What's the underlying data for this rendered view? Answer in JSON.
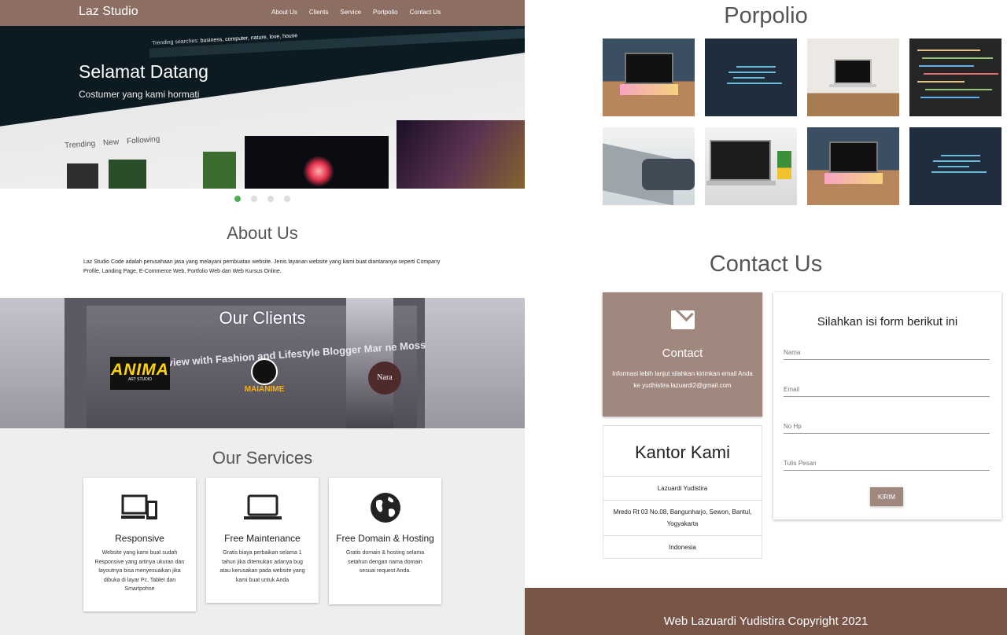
{
  "navbar": {
    "brand": "Laz Studio",
    "links": [
      "About Us",
      "Clients",
      "Service",
      "Portpolio",
      "Contact Us"
    ]
  },
  "hero": {
    "title": "Selamat Datang",
    "subtitle": "Costumer yang kami hormati",
    "trending_label": "Trending searches:",
    "trending_terms": "business, computer, nature, love, house",
    "tabs": [
      "Trending",
      "New",
      "Following"
    ],
    "slides_total": 4,
    "active_slide": 1
  },
  "about": {
    "title": "About Us",
    "text": "Laz Studio Code adalah perusahaan jasa yang melayani pembuatan website. Jenis layanan website yang kami buat diantaranya seperti Company Profile, Landing Page, E-Commerce Web, Portfolio Web dan Web Kursus Online."
  },
  "clients": {
    "title": "Our Clients",
    "background_text": "erview with Fashion and Lifestyle Blogger Mar        ne Moss",
    "logos": [
      {
        "name": "ANIMA",
        "caption": "ART STUDIO"
      },
      {
        "name": "MAIANIME"
      },
      {
        "name": "Nara"
      }
    ]
  },
  "services": {
    "title": "Our Services",
    "items": [
      {
        "icon": "devices-icon",
        "title": "Responsive",
        "text": "Website yang kami buat sudah Responsive yang artinya ukuran dan layoutnya bisa menyesuaikan jika dibuka di layar Pc, Tablet dan Smartpohne"
      },
      {
        "icon": "laptop-icon",
        "title": "Free Maintenance",
        "text": "Gratis biaya perbaikan selama 1 tahun jika ditemukan adanya bug atau kerusakan pada website yang kami buat untuk Anda"
      },
      {
        "icon": "globe-icon",
        "title": "Free Domain & Hosting",
        "text": "Gratis domain & hosting selama setahun dengan nama domain sesuai request Anda."
      }
    ]
  },
  "portfolio": {
    "title": "Porpolio"
  },
  "contact": {
    "title": "Contact Us",
    "card": {
      "icon": "mail-icon",
      "title": "Contact",
      "text": "Informasi lebih lanjut silahkan kirimkan email Anda ke yudhistira.lazuardi2@gmail.com"
    },
    "office": {
      "title": "Kantor Kami",
      "name": "Lazuardi Yudistira",
      "address": "Mredo Rt 03 No.08, Bangunharjo, Sewon, Bantul, Yogyakarta",
      "country": "Indonesia"
    },
    "form": {
      "title": "Silahkan isi form berikut ini",
      "name_placeholder": "Nama",
      "email_placeholder": "Email",
      "phone_placeholder": "No Hp",
      "message_placeholder": "Tulis Pesan",
      "submit_label": "KIRIM"
    }
  },
  "footer": {
    "text": "Web Lazuardi Yudistira Copyright 2021"
  },
  "colors": {
    "navbar": "#8d6e63",
    "accent": "#a1887f",
    "footer": "#795548",
    "slider_active": "#4caf50"
  }
}
